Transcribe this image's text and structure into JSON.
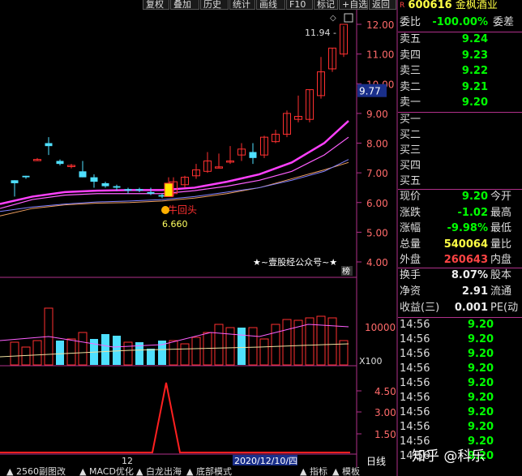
{
  "toolbar": [
    "复权",
    "叠加",
    "历史",
    "统计",
    "画线",
    "F10",
    "标记",
    "+自选",
    "返回"
  ],
  "quote": {
    "code": "600616",
    "name": "金枫酒业",
    "weibi_label": "委比",
    "weibi_value": "-100.00%",
    "weicha_label": "委差",
    "asks": [
      {
        "label": "卖五",
        "price": "9.24"
      },
      {
        "label": "卖四",
        "price": "9.23"
      },
      {
        "label": "卖三",
        "price": "9.22"
      },
      {
        "label": "卖二",
        "price": "9.21"
      },
      {
        "label": "卖一",
        "price": "9.20"
      }
    ],
    "bids": [
      {
        "label": "买一"
      },
      {
        "label": "买二"
      },
      {
        "label": "买三"
      },
      {
        "label": "买四"
      },
      {
        "label": "买五"
      }
    ],
    "stats": [
      {
        "label": "现价",
        "value": "9.20",
        "label2": "今开",
        "color": "green"
      },
      {
        "label": "涨跌",
        "value": "-1.02",
        "label2": "最高",
        "color": "green"
      },
      {
        "label": "涨幅",
        "value": "-9.98%",
        "label2": "最低",
        "color": "green"
      },
      {
        "label": "总量",
        "value": "540064",
        "label2": "量比",
        "color": "yellow"
      },
      {
        "label": "外盘",
        "value": "260643",
        "label2": "内盘",
        "color": "red"
      }
    ],
    "stats2": [
      {
        "label": "换手",
        "value": "8.07%",
        "label2": "股本",
        "color": "white"
      },
      {
        "label": "净资",
        "value": "2.91",
        "label2": "流通",
        "color": "white"
      },
      {
        "label": "收益(三)",
        "value": "0.001",
        "label2": "PE(动",
        "color": "white"
      }
    ],
    "ticks": [
      {
        "time": "14:56",
        "price": "9.20"
      },
      {
        "time": "14:56",
        "price": "9.20"
      },
      {
        "time": "14:56",
        "price": "9.20"
      },
      {
        "time": "14:56",
        "price": "9.20"
      },
      {
        "time": "14:56",
        "price": "9.20"
      },
      {
        "time": "14:56",
        "price": "9.20"
      },
      {
        "time": "14:56",
        "price": "9.20"
      },
      {
        "time": "14:56",
        "price": "9.20"
      },
      {
        "time": "14:56",
        "price": "9.20"
      },
      {
        "time": "14:56",
        "price": "9.20"
      }
    ]
  },
  "chart_data": {
    "type": "candlestick",
    "price_axis": [
      "12.00",
      "11.00",
      "10.00",
      "9.00",
      "8.00",
      "7.00",
      "6.00",
      "5.00",
      "4.00"
    ],
    "price_ylim": [
      4.0,
      12.0
    ],
    "current_price_tag": "9.77",
    "high_label": "11.94",
    "marker_label": "牛回头",
    "marker_price": "6.660",
    "banner": "★~壹股经公众号~★",
    "banner_badge": "榜",
    "volume_axis": "10000",
    "volume_unit": "X100",
    "indicator_axis": [
      "4.50",
      "3.00",
      "1.50"
    ],
    "date_label": "2020/12/10/四",
    "x_tick": "12",
    "day_line": "日线",
    "tabs": [
      "2560副图改",
      "MACD优化",
      "白龙出海",
      "底部模式",
      "指标",
      "模板"
    ]
  },
  "watermark": "知乎 @科乐"
}
